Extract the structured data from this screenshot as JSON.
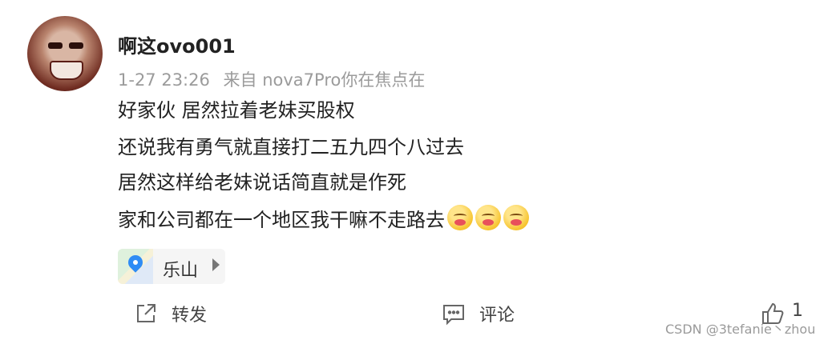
{
  "post": {
    "username": "啊这ovo001",
    "time": "1-27 23:26",
    "source": "来自 nova7Pro你在焦点在",
    "lines": [
      "好家伙 居然拉着老妹买股权",
      "还说我有勇气就直接打二五九四个八过去",
      "居然这样给老妹说话简直就是作死",
      "家和公司都在一个地区我干嘛不走路去"
    ],
    "emoji_icons": [
      "hot-face-emoji",
      "hot-face-emoji",
      "hot-face-emoji"
    ],
    "location": "乐山"
  },
  "actions": {
    "share_label": "转发",
    "comment_label": "评论",
    "like_count": "1"
  },
  "watermark": "CSDN @3tefanie丶zhou",
  "colors": {
    "meta_gray": "#9b9b9b",
    "pin_blue": "#2f8cf5",
    "background": "#ffffff"
  }
}
